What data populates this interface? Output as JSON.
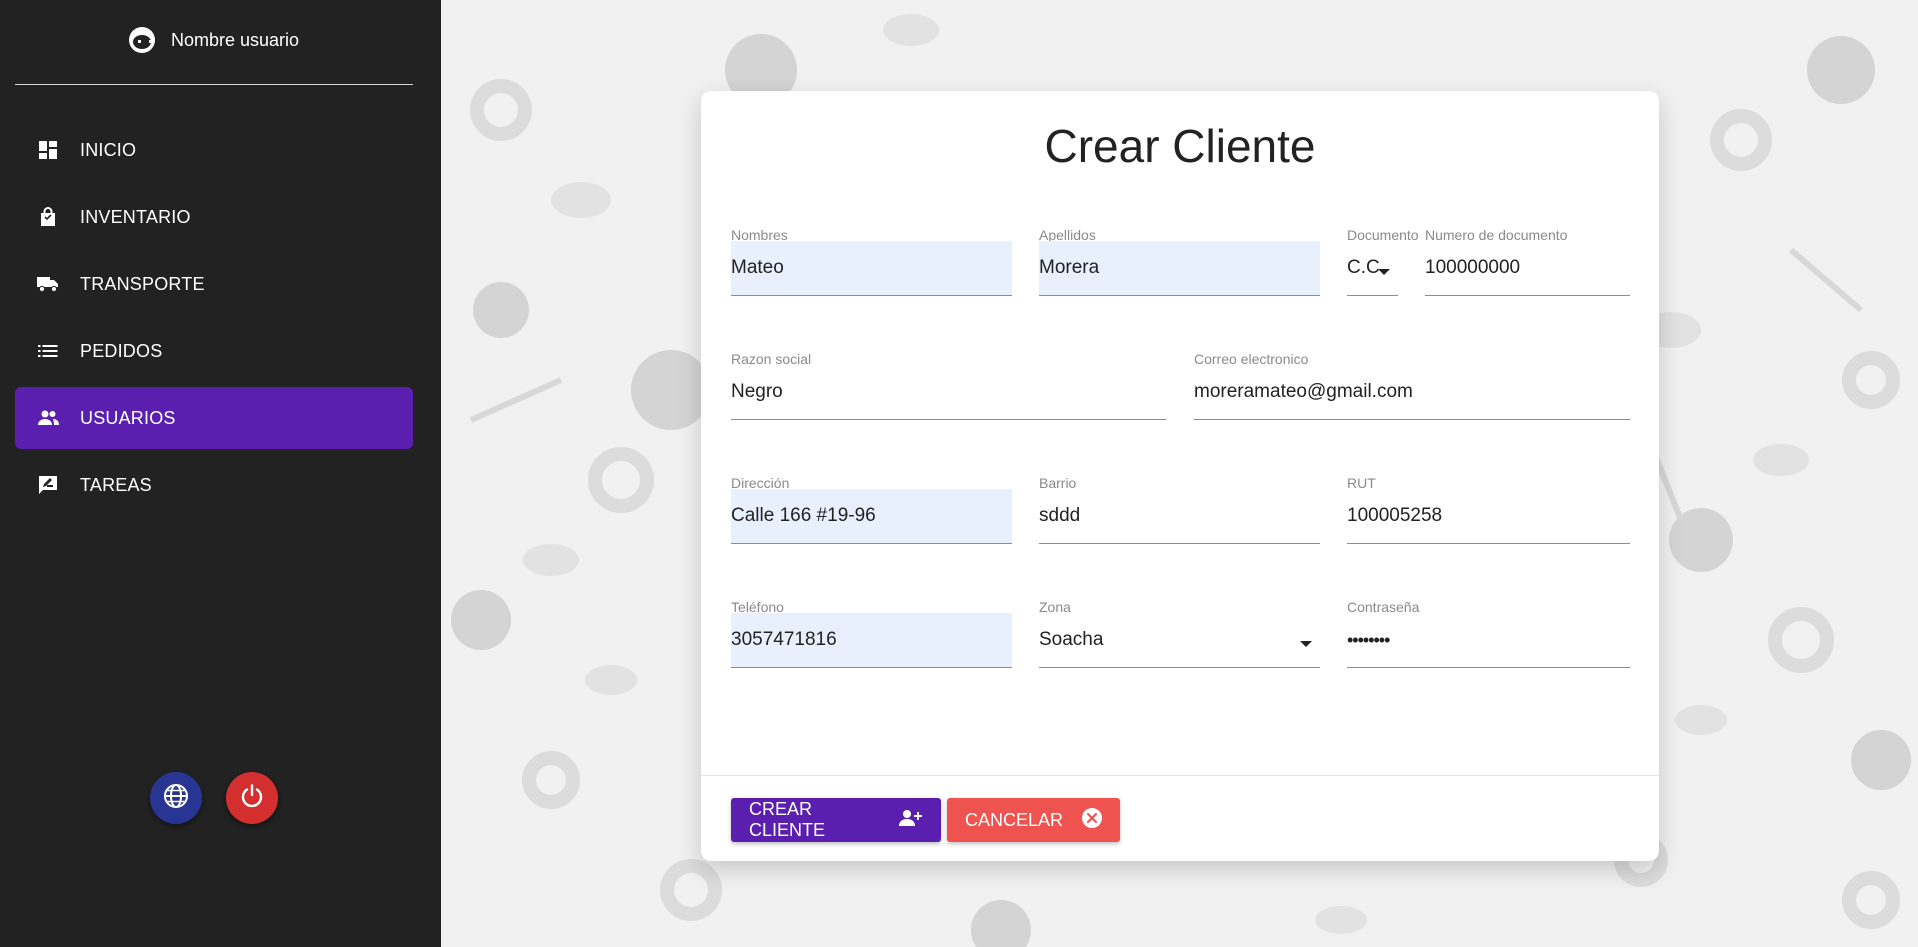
{
  "sidebar": {
    "user_name": "Nombre usuario",
    "items": [
      {
        "label": "INICIO",
        "icon": "dashboard-icon"
      },
      {
        "label": "INVENTARIO",
        "icon": "shopping-bag-icon"
      },
      {
        "label": "TRANSPORTE",
        "icon": "truck-icon"
      },
      {
        "label": "PEDIDOS",
        "icon": "list-icon"
      },
      {
        "label": "USUARIOS",
        "icon": "users-icon",
        "active": true
      },
      {
        "label": "TAREAS",
        "icon": "feedback-icon"
      }
    ],
    "bottom_buttons": [
      "globe-icon",
      "power-icon"
    ]
  },
  "form": {
    "title": "Crear Cliente",
    "fields": {
      "nombres": {
        "label": "Nombres",
        "value": "Mateo"
      },
      "apellidos": {
        "label": "Apellidos",
        "value": "Morera"
      },
      "documento": {
        "label": "Documento",
        "value": "C.C"
      },
      "numero_documento": {
        "label": "Numero de documento",
        "value": "100000000"
      },
      "razon_social": {
        "label": "Razon social",
        "value": "Negro"
      },
      "correo": {
        "label": "Correo electronico",
        "value": "moreramateo@gmail.com"
      },
      "direccion": {
        "label": "Dirección",
        "value": "Calle 166 #19-96"
      },
      "barrio": {
        "label": "Barrio",
        "value": "sddd"
      },
      "rut": {
        "label": "RUT",
        "value": "100005258"
      },
      "telefono": {
        "label": "Teléfono",
        "value": "3057471816"
      },
      "zona": {
        "label": "Zona",
        "value": "Soacha"
      },
      "contrasena": {
        "label": "Contraseña",
        "value": "••••••••"
      }
    },
    "buttons": {
      "create": "CREAR CLIENTE",
      "cancel": "CANCELAR"
    }
  },
  "colors": {
    "sidebar_bg": "#222222",
    "accent": "#5b1fb0",
    "danger": "#ef5350",
    "autofill": "#e8f0fe"
  }
}
